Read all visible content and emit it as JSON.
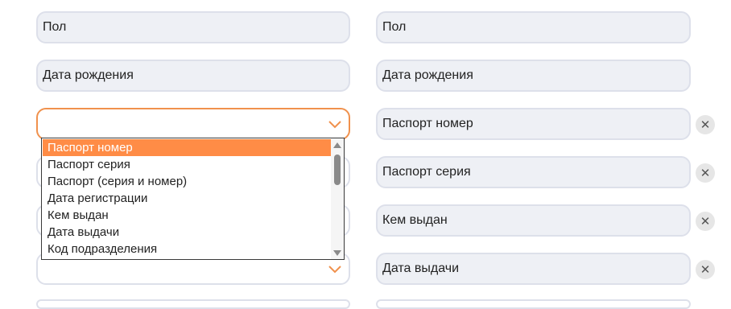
{
  "left_fields": [
    {
      "value": "Пол"
    },
    {
      "value": "Дата рождения"
    },
    {
      "value": ""
    }
  ],
  "right_fields": [
    {
      "value": "Пол"
    },
    {
      "value": "Дата рождения"
    },
    {
      "value": "Паспорт номер",
      "removable": true
    },
    {
      "value": "Паспорт серия",
      "removable": true
    },
    {
      "value": "Кем выдан",
      "removable": true
    },
    {
      "value": "Дата выдачи",
      "removable": true
    }
  ],
  "dropdown": {
    "selected": "Паспорт номер",
    "options": [
      "Паспорт номер",
      "Паспорт серия",
      "Паспорт (серия и номер)",
      "Дата регистрации",
      "Кем выдан",
      "Дата выдачи",
      "Код подразделения"
    ]
  },
  "icons": {
    "remove": "close-icon",
    "expand": "chevron-down-icon"
  },
  "colors": {
    "accent": "#ff8c46",
    "field_bg": "#eef0f5",
    "field_border": "#dde0ea"
  }
}
